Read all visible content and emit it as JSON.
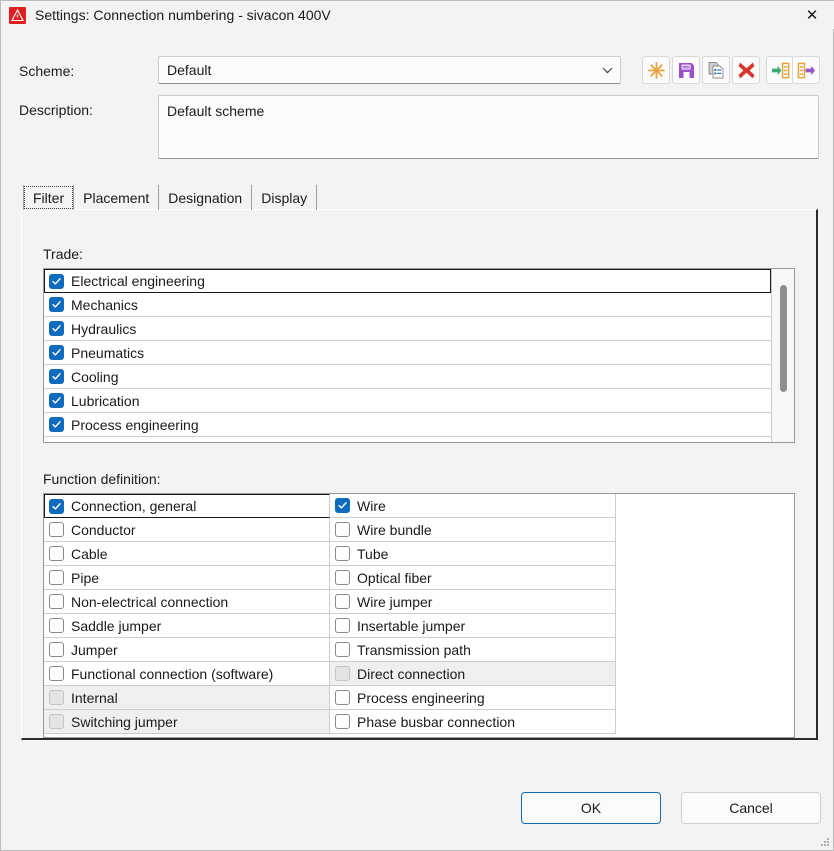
{
  "window": {
    "title": "Settings: Connection numbering - sivacon 400V",
    "icon": "warning-triangle-icon",
    "close_label": "✕"
  },
  "form": {
    "scheme_label": "Scheme:",
    "scheme_value": "Default",
    "scheme_placeholder": "Default",
    "description_label": "Description:",
    "description_value": "Default scheme"
  },
  "toolbar": {
    "buttons": [
      {
        "name": "new-scheme-button",
        "icon": "asterisk-icon",
        "color": "#e8a33d"
      },
      {
        "name": "save-scheme-button",
        "icon": "floppy-disk-icon",
        "color": "#9b51c8"
      },
      {
        "name": "copy-scheme-button",
        "icon": "copy-documents-icon",
        "color": "#8a8a8a"
      },
      {
        "name": "delete-scheme-button",
        "icon": "red-x-icon",
        "color": "#d9352c"
      },
      {
        "name": "import-scheme-button",
        "icon": "import-arrow-icon",
        "color": "#3faa78"
      },
      {
        "name": "export-scheme-button",
        "icon": "export-arrow-icon",
        "color": "#9b51c8"
      }
    ]
  },
  "tabs": [
    {
      "label": "Filter",
      "active": true
    },
    {
      "label": "Placement",
      "active": false
    },
    {
      "label": "Designation",
      "active": false
    },
    {
      "label": "Display",
      "active": false
    }
  ],
  "trade": {
    "label": "Trade:",
    "items": [
      {
        "label": "Electrical engineering",
        "checked": true,
        "disabled": false,
        "focused": true
      },
      {
        "label": "Mechanics",
        "checked": true,
        "disabled": false,
        "focused": false
      },
      {
        "label": "Hydraulics",
        "checked": true,
        "disabled": false,
        "focused": false
      },
      {
        "label": "Pneumatics",
        "checked": true,
        "disabled": false,
        "focused": false
      },
      {
        "label": "Cooling",
        "checked": true,
        "disabled": false,
        "focused": false
      },
      {
        "label": "Lubrication",
        "checked": true,
        "disabled": false,
        "focused": false
      },
      {
        "label": "Process engineering",
        "checked": true,
        "disabled": false,
        "focused": false
      }
    ],
    "scrollbar": {
      "thumb_top_pct": 9,
      "thumb_height_pct": 62
    }
  },
  "function_definition": {
    "label": "Function definition:",
    "columns": [
      [
        {
          "label": "Connection, general",
          "checked": true,
          "disabled": false,
          "focused": true
        },
        {
          "label": "Conductor",
          "checked": false,
          "disabled": false,
          "focused": false
        },
        {
          "label": "Cable",
          "checked": false,
          "disabled": false,
          "focused": false
        },
        {
          "label": "Pipe",
          "checked": false,
          "disabled": false,
          "focused": false
        },
        {
          "label": "Non-electrical connection",
          "checked": false,
          "disabled": false,
          "focused": false
        },
        {
          "label": "Saddle jumper",
          "checked": false,
          "disabled": false,
          "focused": false
        },
        {
          "label": "Jumper",
          "checked": false,
          "disabled": false,
          "focused": false
        },
        {
          "label": "Functional connection (software)",
          "checked": false,
          "disabled": false,
          "focused": false
        },
        {
          "label": "Internal",
          "checked": false,
          "disabled": true,
          "focused": false
        },
        {
          "label": "Switching jumper",
          "checked": false,
          "disabled": true,
          "focused": false
        }
      ],
      [
        {
          "label": "Wire",
          "checked": true,
          "disabled": false,
          "focused": false
        },
        {
          "label": "Wire bundle",
          "checked": false,
          "disabled": false,
          "focused": false
        },
        {
          "label": "Tube",
          "checked": false,
          "disabled": false,
          "focused": false
        },
        {
          "label": "Optical fiber",
          "checked": false,
          "disabled": false,
          "focused": false
        },
        {
          "label": "Wire jumper",
          "checked": false,
          "disabled": false,
          "focused": false
        },
        {
          "label": "Insertable jumper",
          "checked": false,
          "disabled": false,
          "focused": false
        },
        {
          "label": "Transmission path",
          "checked": false,
          "disabled": false,
          "focused": false
        },
        {
          "label": "Direct connection",
          "checked": false,
          "disabled": true,
          "focused": false
        },
        {
          "label": "Process engineering",
          "checked": false,
          "disabled": false,
          "focused": false
        },
        {
          "label": "Phase busbar connection",
          "checked": false,
          "disabled": false,
          "focused": false
        }
      ]
    ]
  },
  "footer": {
    "ok_label": "OK",
    "cancel_label": "Cancel"
  },
  "colors": {
    "accent": "#0f6cbd",
    "dialog_bg": "#f3f3f3",
    "list_bg": "#ffffff",
    "disabled_row_bg": "#efefef"
  }
}
